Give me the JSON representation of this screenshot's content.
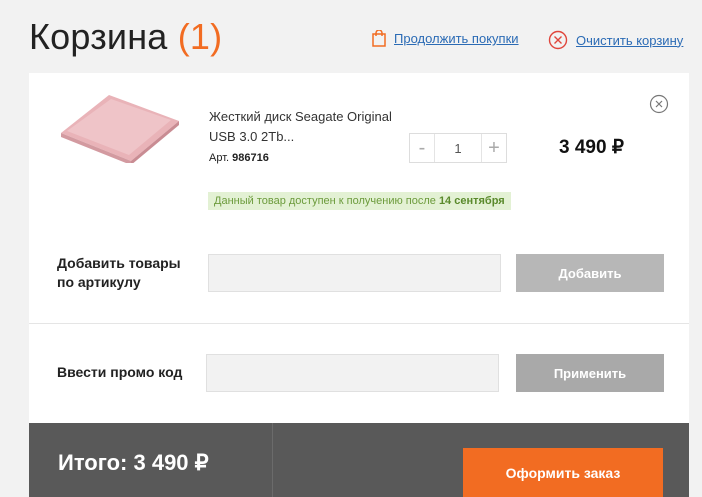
{
  "header": {
    "title": "Корзина",
    "count": "(1)",
    "continue_label": "Продолжить покупки",
    "clear_label": "Очистить корзину"
  },
  "item": {
    "name": "Жесткий диск Seagate Original USB 3.0 2Tb...",
    "sku_label": "Арт.",
    "sku": "986716",
    "quantity": "1",
    "minus": "-",
    "plus": "+",
    "price": "3 490 ₽",
    "availability_text": "Данный товар доступен к получению после",
    "availability_date": "14 сентября"
  },
  "add_by_sku": {
    "label_line1": "Добавить товары",
    "label_line2": "по артикулу",
    "input_value": "",
    "button_label": "Добавить"
  },
  "promo": {
    "label": "Ввести промо код",
    "input_value": "",
    "button_label": "Применить"
  },
  "footer": {
    "total": "Итого: 3 490 ₽",
    "checkout_label": "Оформить заказ"
  },
  "colors": {
    "accent": "#f26c22",
    "link": "#2b6bb5",
    "footer_bg": "#595959",
    "availability_bg": "#e3f1d4"
  },
  "icons": {
    "continue": "shopping-bag-icon",
    "clear": "clear-cart-icon",
    "remove": "remove-item-icon"
  }
}
